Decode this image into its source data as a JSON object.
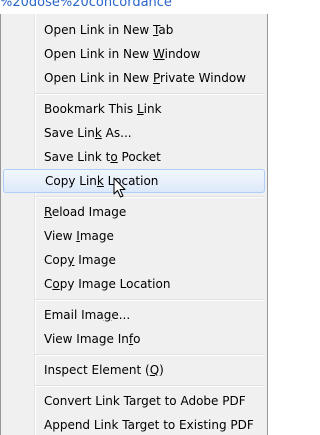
{
  "link_fragment": "%20dose%20concordance",
  "menu": {
    "group1": [
      {
        "pre": "Open Link in New ",
        "key": "T",
        "post": "ab"
      },
      {
        "pre": "Open Link in New ",
        "key": "W",
        "post": "indow"
      },
      {
        "pre": "Open Link in New ",
        "key": "P",
        "post": "rivate Window"
      }
    ],
    "group2": [
      {
        "pre": "Bookmark This ",
        "key": "L",
        "post": "ink"
      },
      {
        "pre": "Save Lin",
        "key": "k",
        "post": " As..."
      },
      {
        "pre": "Save Link t",
        "key": "o",
        "post": " Pocket"
      },
      {
        "pre": "Copy Lin",
        "key": "k",
        "post": " Location"
      }
    ],
    "group3": [
      {
        "pre": "",
        "key": "R",
        "post": "eload Image"
      },
      {
        "pre": "View ",
        "key": "I",
        "post": "mage"
      },
      {
        "pre": "Cop",
        "key": "y",
        "post": " Image"
      },
      {
        "pre": "C",
        "key": "o",
        "post": "py Image Location"
      }
    ],
    "group4": [
      {
        "pre": "Email Ima",
        "key": "g",
        "post": "e..."
      },
      {
        "pre": "View Image In",
        "key": "f",
        "post": "o"
      }
    ],
    "group5": [
      {
        "pre": "Inspect Element (",
        "key": "Q",
        "post": ")"
      }
    ],
    "group6": [
      {
        "pre": "Convert Link Target to Adobe PDF",
        "key": "",
        "post": ""
      },
      {
        "pre": "Append Link Target to Existing PDF",
        "key": "",
        "post": ""
      }
    ]
  },
  "highlighted_item": "Copy Link Location",
  "cursor_icon": "mouse-pointer-icon"
}
